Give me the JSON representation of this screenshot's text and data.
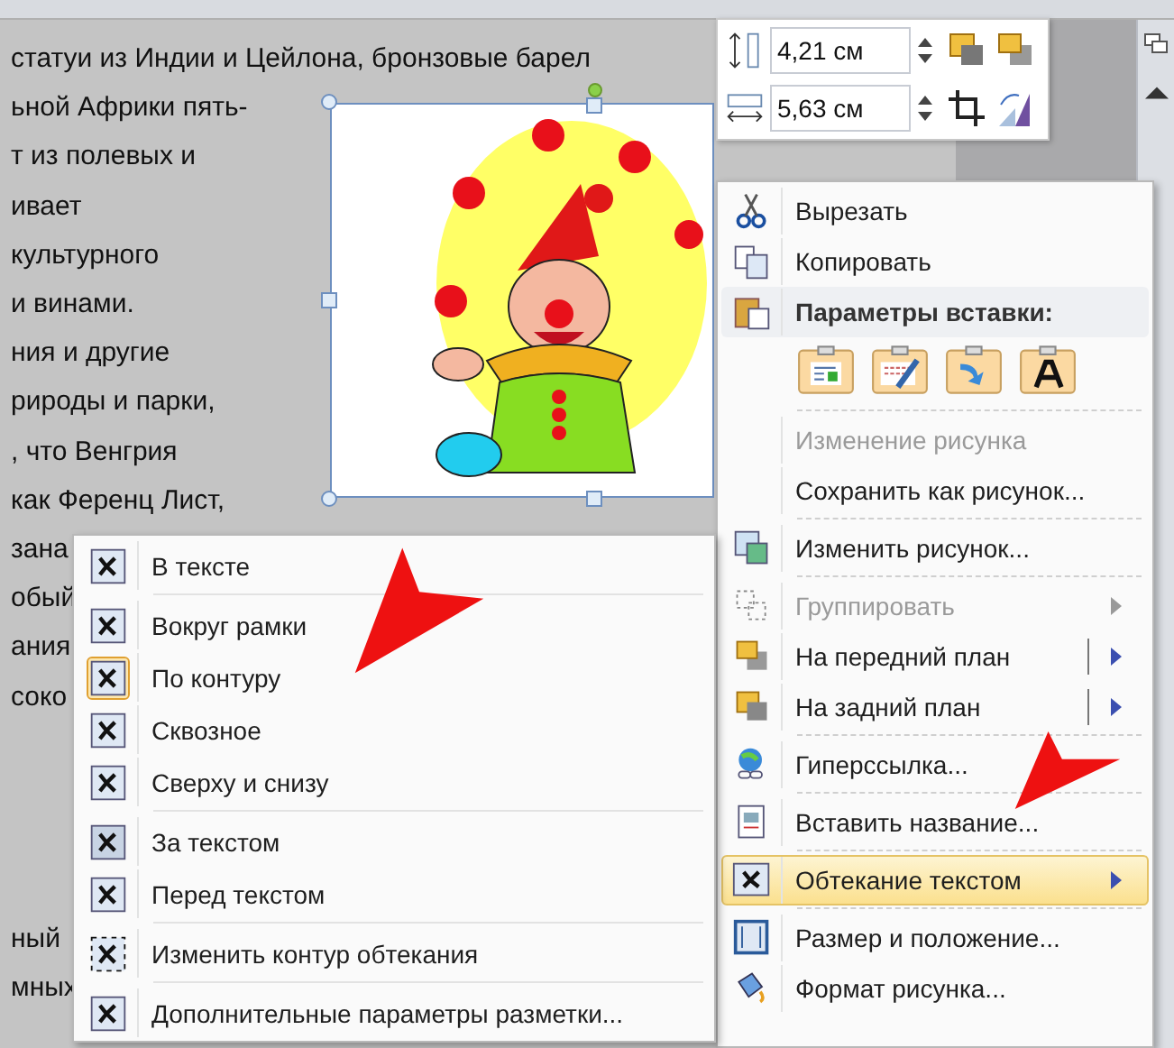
{
  "document": {
    "lines_top": [
      "статуи из Индии и Цейлона, бронзовые барел",
      "ьной Африки пять-",
      "т из полевых и",
      "ивает",
      "культурного",
      "и винами.",
      "ния и другие",
      "рироды и парки,",
      ", что Венгрия",
      "как Ференц Лист,",
      "зана",
      "обый",
      "ания",
      "соко"
    ],
    "lines_bottom": [
      "ный",
      "мных"
    ]
  },
  "mini_toolbar": {
    "height_field": {
      "value": "4,21 см"
    },
    "width_field": {
      "value": "5,63 см"
    }
  },
  "context_menu": {
    "groups": [
      [
        {
          "kind": "item",
          "label": "Вырезать",
          "disabled": false,
          "selected": false,
          "submenu": false
        },
        {
          "kind": "item",
          "label": "Копировать",
          "disabled": false,
          "selected": false,
          "submenu": false
        },
        {
          "kind": "paste-header",
          "label": "Параметры вставки:",
          "disabled": false,
          "selected": false,
          "submenu": false
        }
      ],
      [
        {
          "kind": "item",
          "label": "Изменение рисунка",
          "disabled": true,
          "selected": false,
          "submenu": false
        },
        {
          "kind": "item",
          "label": "Сохранить как рисунок...",
          "disabled": false,
          "selected": false,
          "submenu": false
        }
      ],
      [
        {
          "kind": "item",
          "label": "Изменить рисунок...",
          "disabled": false,
          "selected": false,
          "submenu": false
        }
      ],
      [
        {
          "kind": "item",
          "label": "Группировать",
          "disabled": true,
          "selected": false,
          "submenu": true
        },
        {
          "kind": "split",
          "label": "На передний план",
          "disabled": false,
          "selected": false,
          "submenu": true
        },
        {
          "kind": "split",
          "label": "На задний план",
          "disabled": false,
          "selected": false,
          "submenu": true
        }
      ],
      [
        {
          "kind": "item",
          "label": "Гиперссылка...",
          "disabled": false,
          "selected": false,
          "submenu": false
        }
      ],
      [
        {
          "kind": "item",
          "label": "Вставить название...",
          "disabled": false,
          "selected": false,
          "submenu": false
        }
      ],
      [
        {
          "kind": "item",
          "label": "Обтекание текстом",
          "disabled": false,
          "selected": true,
          "submenu": true
        }
      ],
      [
        {
          "kind": "item",
          "label": "Размер и положение...",
          "disabled": false,
          "selected": false,
          "submenu": false
        },
        {
          "kind": "item",
          "label": "Формат рисунка...",
          "disabled": false,
          "selected": false,
          "submenu": false
        }
      ]
    ]
  },
  "wrap_submenu": {
    "groups": [
      [
        {
          "label": "В тексте",
          "checked": false
        }
      ],
      [
        {
          "label": "Вокруг рамки",
          "checked": false
        },
        {
          "label": "По контуру",
          "checked": true
        },
        {
          "label": "Сквозное",
          "checked": false
        },
        {
          "label": "Сверху и снизу",
          "checked": false
        }
      ],
      [
        {
          "label": "За текстом",
          "checked": false
        },
        {
          "label": "Перед текстом",
          "checked": false
        }
      ],
      [
        {
          "label": "Изменить контур обтекания",
          "checked": false
        }
      ],
      [
        {
          "label": "Дополнительные параметры разметки...",
          "checked": false
        }
      ]
    ]
  }
}
